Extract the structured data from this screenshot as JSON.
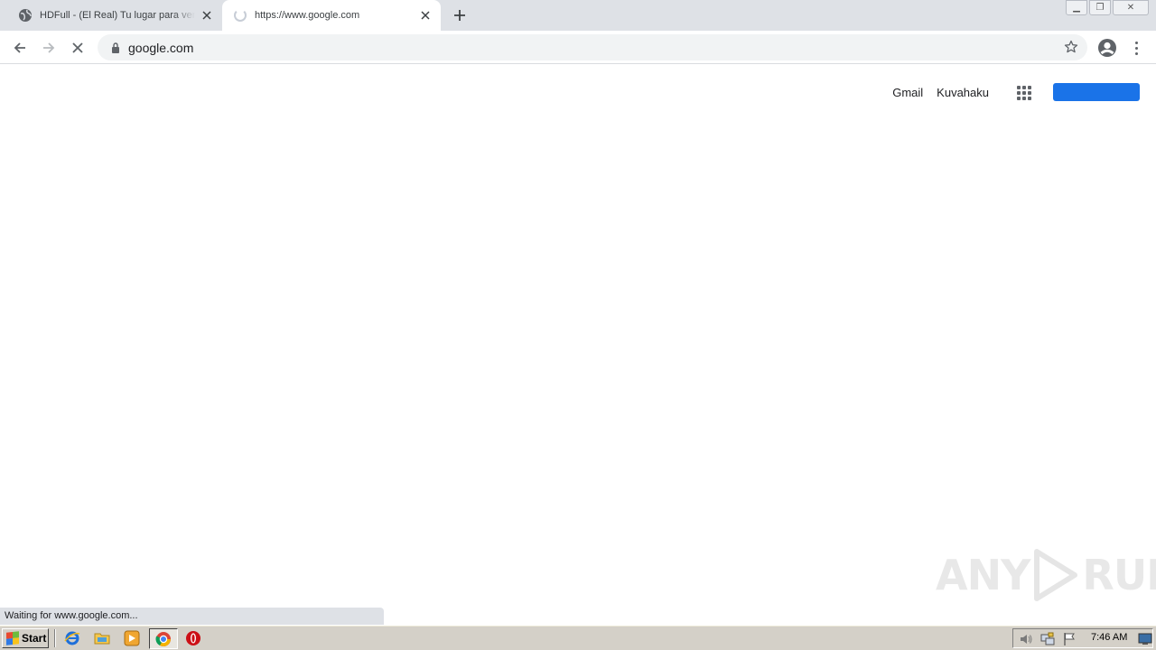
{
  "browser": {
    "tabs": [
      {
        "title": "HDFull - (El Real) Tu lugar para ver películas y series",
        "favicon": "globe-icon",
        "active": false
      },
      {
        "title": "https://www.google.com",
        "favicon": "loading-spinner-icon",
        "active": true
      }
    ],
    "new_tab_icon": "plus-icon",
    "window_controls": [
      "minimize-icon",
      "restore-icon",
      "close-icon"
    ],
    "address": "google.com",
    "status_text": "Waiting for www.google.com..."
  },
  "page": {
    "header_links": [
      "Gmail",
      "Kuvahaku"
    ],
    "apps_icon": "apps-grid-icon",
    "signin_label": "",
    "accent_color": "#1a73e8"
  },
  "watermark": {
    "left": "ANY",
    "right": "RUN"
  },
  "taskbar": {
    "start_label": "Start",
    "quick_launch": [
      "internet-explorer-icon",
      "folder-icon",
      "media-player-icon",
      "chrome-icon",
      "opera-icon"
    ],
    "tray_icons": [
      "volume-icon",
      "network-icon",
      "flag-icon",
      "show-desktop-icon"
    ],
    "clock": "7:46 AM"
  }
}
